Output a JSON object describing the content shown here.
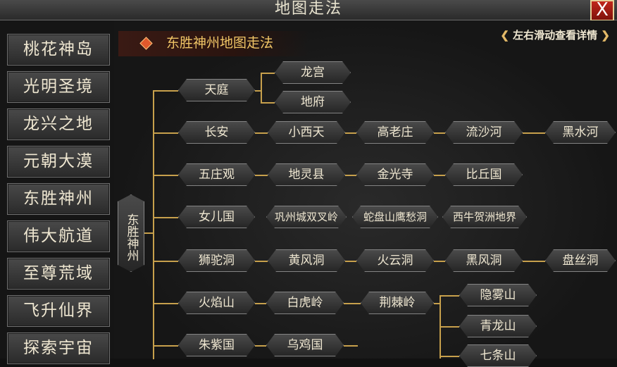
{
  "window": {
    "title": "地图走法",
    "close_label": "X"
  },
  "sidebar": {
    "items": [
      "桃花神岛",
      "光明圣境",
      "龙兴之地",
      "元朝大漠",
      "东胜神州",
      "伟大航道",
      "至尊荒域",
      "飞升仙界",
      "探索宇宙"
    ]
  },
  "header": {
    "section_title": "东胜神州地图走法",
    "hint": "左右滑动查看详情"
  },
  "tree": {
    "root": "东胜神州",
    "rows": [
      [
        "天庭"
      ],
      [
        "长安",
        "小西天",
        "高老庄",
        "流沙河",
        "黑水河"
      ],
      [
        "五庄观",
        "地灵县",
        "金光寺",
        "比丘国"
      ],
      [
        "女儿国",
        "巩州城双叉岭",
        "蛇盘山鹰愁洞",
        "西牛贺洲地界"
      ],
      [
        "狮驼洞",
        "黄风洞",
        "火云洞",
        "黑风洞",
        "盘丝洞"
      ],
      [
        "火焰山",
        "白虎岭",
        "荆棘岭"
      ],
      [
        "朱紫国",
        "乌鸡国"
      ]
    ],
    "tianting_children": [
      "龙宫",
      "地府"
    ],
    "jingjiling_children": [
      "隐雾山",
      "青龙山",
      "七条山"
    ]
  },
  "colors": {
    "accent": "#f0c566",
    "line": "#c7a04c",
    "close": "#c1271b"
  }
}
